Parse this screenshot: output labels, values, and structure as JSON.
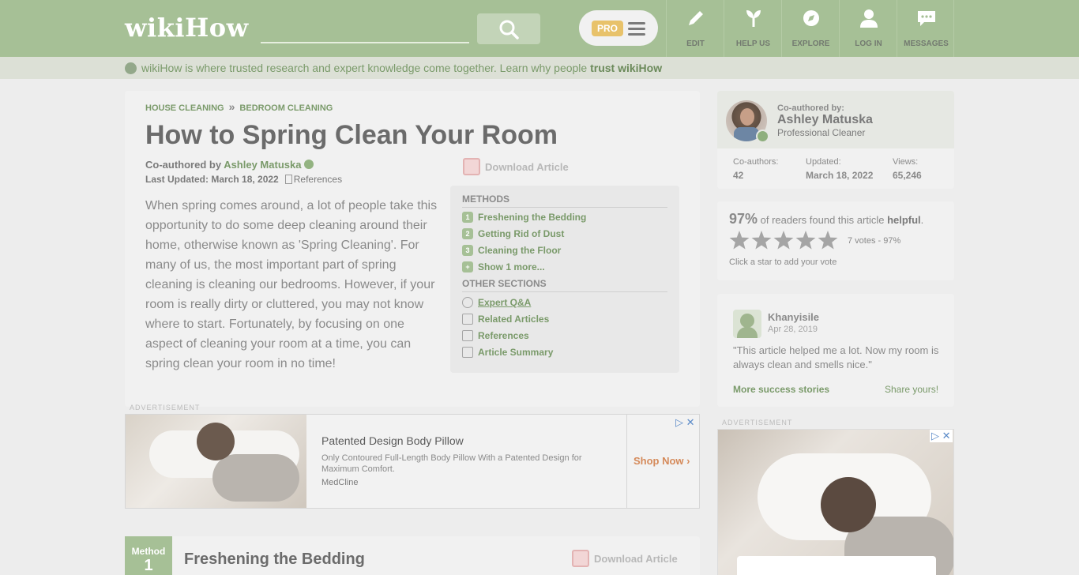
{
  "header": {
    "logo_wiki": "wiki",
    "logo_how": "How",
    "search": {
      "placeholder": ""
    },
    "pro_label": "PRO",
    "nav": [
      {
        "label": "EDIT",
        "icon": "pencil-icon"
      },
      {
        "label": "HELP US",
        "icon": "sprout-icon"
      },
      {
        "label": "EXPLORE",
        "icon": "compass-icon"
      },
      {
        "label": "LOG IN",
        "icon": "user-icon"
      },
      {
        "label": "MESSAGES",
        "icon": "chat-icon"
      }
    ]
  },
  "trust_bar": {
    "text": "wikiHow is where trusted research and expert knowledge come together. Learn why people ",
    "link": "trust wikiHow"
  },
  "article": {
    "breadcrumb": [
      "HOUSE CLEANING",
      "BEDROOM CLEANING"
    ],
    "breadcrumb_sep": "»",
    "title": "How to Spring Clean Your Room",
    "coauthored_prefix": "Co-authored by ",
    "coauthor_name": "Ashley Matuska",
    "last_updated_label": "Last Updated: ",
    "last_updated": "March 18, 2022",
    "references_label": "References",
    "download_label": "Download Article",
    "intro": "When spring comes around, a lot of people take this opportunity to do some deep cleaning around their home, otherwise known as 'Spring Cleaning'. For many of us, the most important part of spring cleaning is cleaning our bedrooms. However, if your room is really dirty or cluttered, you may not know where to start. Fortunately, by focusing on one aspect of cleaning your room at a time, you can spring clean your room in no time!"
  },
  "toc": {
    "methods_heading": "METHODS",
    "methods": [
      {
        "num": "1",
        "label": "Freshening the Bedding"
      },
      {
        "num": "2",
        "label": "Getting Rid of Dust"
      },
      {
        "num": "3",
        "label": "Cleaning the Floor"
      },
      {
        "num": "+",
        "label": "Show 1 more..."
      }
    ],
    "other_heading": "OTHER SECTIONS",
    "other": [
      {
        "label": "Expert Q&A",
        "icon": "question-icon"
      },
      {
        "label": "Related Articles",
        "icon": "document-icon"
      },
      {
        "label": "References",
        "icon": "bookmark-icon"
      },
      {
        "label": "Article Summary",
        "icon": "summary-icon"
      }
    ]
  },
  "ad": {
    "label": "ADVERTISEMENT",
    "title": "Patented Design Body Pillow",
    "description": "Only Contoured Full-Length Body Pillow With a Patented Design for Maximum Comfort.",
    "brand": "MedCline",
    "cta": "Shop Now",
    "close": "▷ ✕"
  },
  "method": {
    "word": "Method",
    "number": "1",
    "title": "Freshening the Bedding",
    "download_label": "Download Article"
  },
  "author_card": {
    "coauthored_by": "Co-authored by:",
    "name": "Ashley Matuska",
    "title": "Professional Cleaner",
    "stats": [
      {
        "label": "Co-authors:",
        "value": "42"
      },
      {
        "label": "Updated:",
        "value": "March 18, 2022"
      },
      {
        "label": "Views:",
        "value": "65,246"
      }
    ]
  },
  "rating": {
    "percent": "97%",
    "text_mid": " of readers found this article ",
    "helpful": "helpful",
    "period": ".",
    "stars": 5,
    "votes": "7 votes - 97%",
    "hint": "Click a star to add your vote"
  },
  "testimonial": {
    "name": "Khanyisile",
    "date": "Apr 28, 2019",
    "quote": "\"This article helped me a lot. Now my room is always clean and smells nice.\"",
    "more_link": "More success stories",
    "share_link": "Share yours!"
  },
  "side_ad": {
    "label": "ADVERTISEMENT",
    "close": "▷ ✕"
  },
  "colors": {
    "brand_green": "#a6c096",
    "link_green": "#7a9a6a",
    "pro_gold": "#e8c26a"
  }
}
